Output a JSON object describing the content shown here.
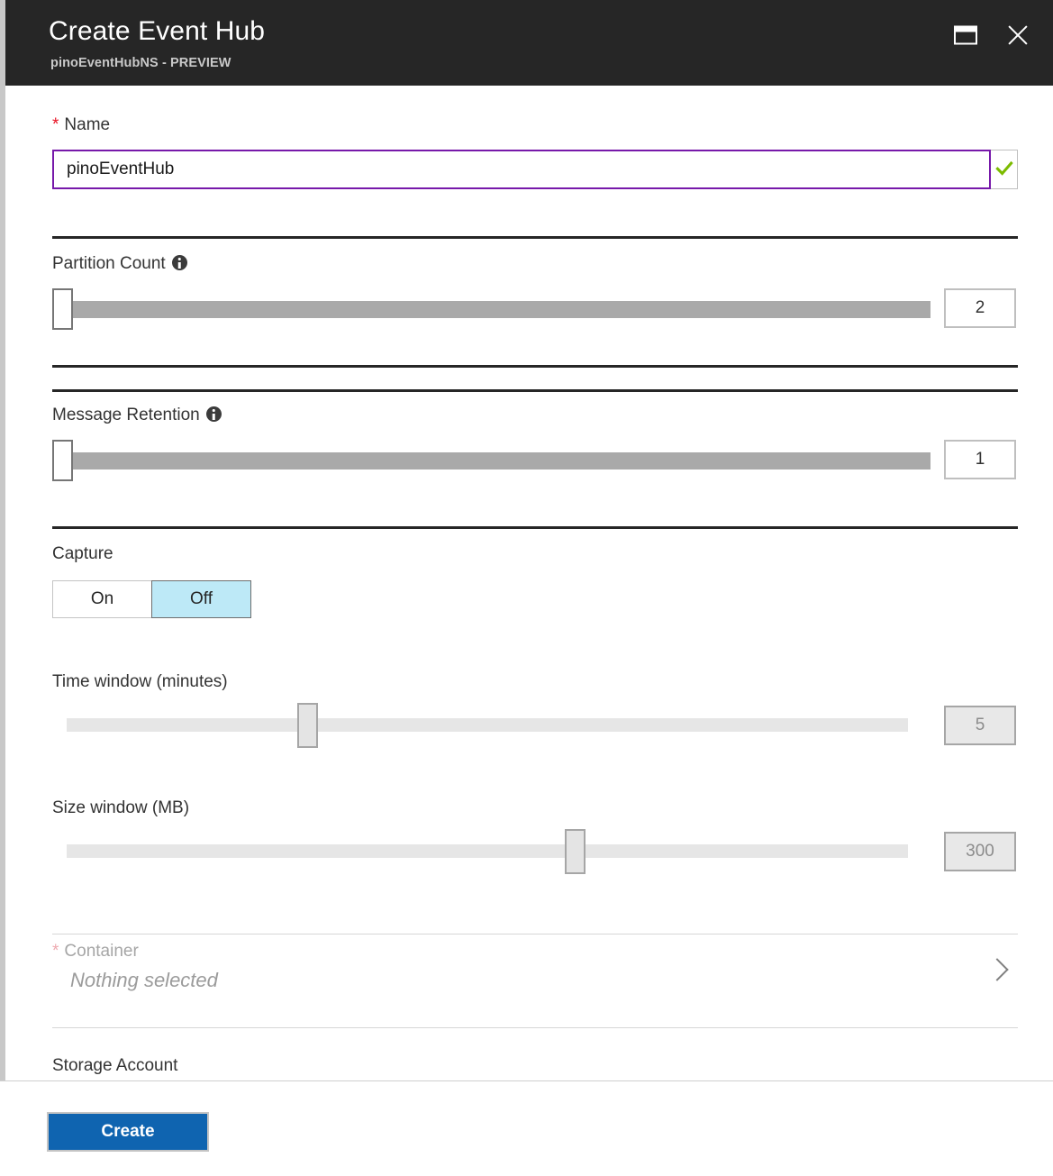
{
  "header": {
    "title": "Create Event Hub",
    "subtitle": "pinoEventHubNS - PREVIEW",
    "maximize_icon": "maximize-icon",
    "close_icon": "close-icon"
  },
  "form": {
    "name": {
      "label": "Name",
      "required_marker": "*",
      "value": "pinoEventHub",
      "placeholder": "",
      "validation_icon": "green-check-icon",
      "validation_color": "#7cbb00",
      "focus_border_color": "#7719aa"
    },
    "partition_count": {
      "label": "Partition Count",
      "info_icon": "info-icon",
      "value": "2",
      "slider_percent": 0
    },
    "message_retention": {
      "label": "Message Retention",
      "info_icon": "info-icon",
      "value": "1",
      "slider_percent": 0
    },
    "capture": {
      "label": "Capture",
      "options": [
        "On",
        "Off"
      ],
      "selected": "Off",
      "selected_color": "#bde9f7"
    },
    "time_window": {
      "label": "Time window (minutes)",
      "value": "5",
      "slider_percent": 28,
      "disabled": true
    },
    "size_window": {
      "label": "Size window (MB)",
      "value": "300",
      "slider_percent": 59,
      "disabled": true
    },
    "container": {
      "label": "Container",
      "required_marker": "*",
      "value": "Nothing selected",
      "chevron_icon": "chevron-right-icon",
      "disabled": true
    },
    "storage_account": {
      "label": "Storage Account"
    }
  },
  "footer": {
    "create_label": "Create",
    "create_color": "#0f64b0"
  }
}
